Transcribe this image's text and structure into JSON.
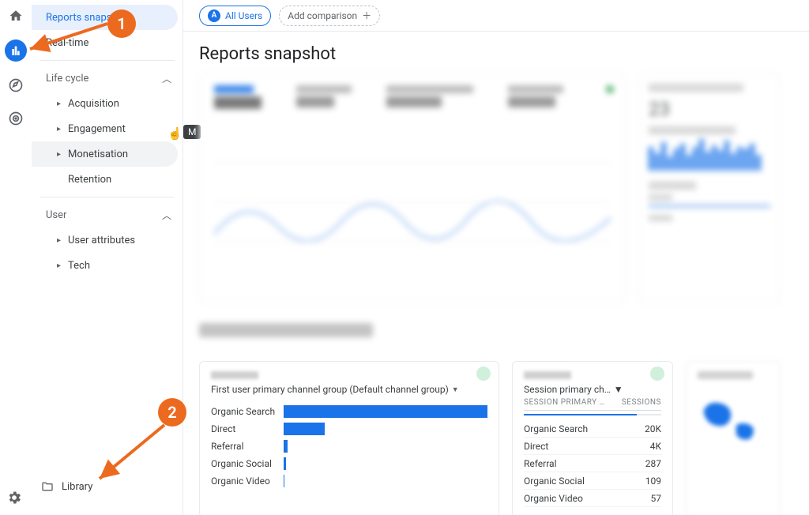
{
  "rail": {
    "home": "home-icon",
    "reports": "reports-icon",
    "explore": "explore-icon",
    "ads": "ads-icon",
    "settings": "settings-icon"
  },
  "nav": {
    "reports_snapshot": "Reports snapshot",
    "realtime": "Real-time",
    "lifecycle": "Life cycle",
    "acquisition": "Acquisition",
    "engagement": "Engagement",
    "monetisation": "Monetisation",
    "retention": "Retention",
    "user": "User",
    "user_attributes": "User attributes",
    "tech": "Tech"
  },
  "tooltip": "M",
  "library": "Library",
  "topbar": {
    "all_users": "All Users",
    "all_users_badge": "A",
    "add_comparison": "Add comparison"
  },
  "title": "Reports snapshot",
  "side": {
    "value": "23"
  },
  "callouts": {
    "one": "1",
    "two": "2"
  },
  "channel_card": {
    "title": "First user primary channel group (Default channel group)",
    "rows": [
      "Organic Search",
      "Direct",
      "Referral",
      "Organic Social",
      "Organic Video"
    ]
  },
  "session_card": {
    "title": "Session primary ch…",
    "col1": "SESSION PRIMARY …",
    "col2": "SESSIONS",
    "rows": [
      {
        "label": "Organic Search",
        "val": "20K"
      },
      {
        "label": "Direct",
        "val": "4K"
      },
      {
        "label": "Referral",
        "val": "287"
      },
      {
        "label": "Organic Social",
        "val": "109"
      },
      {
        "label": "Organic Video",
        "val": "57"
      }
    ]
  },
  "chart_data": {
    "type": "bar",
    "title": "First user primary channel group (Default channel group)",
    "categories": [
      "Organic Search",
      "Direct",
      "Referral",
      "Organic Social",
      "Organic Video"
    ],
    "values": [
      20000,
      4000,
      287,
      109,
      57
    ],
    "xlabel": "",
    "ylabel": "",
    "ylim": [
      0,
      20000
    ]
  }
}
